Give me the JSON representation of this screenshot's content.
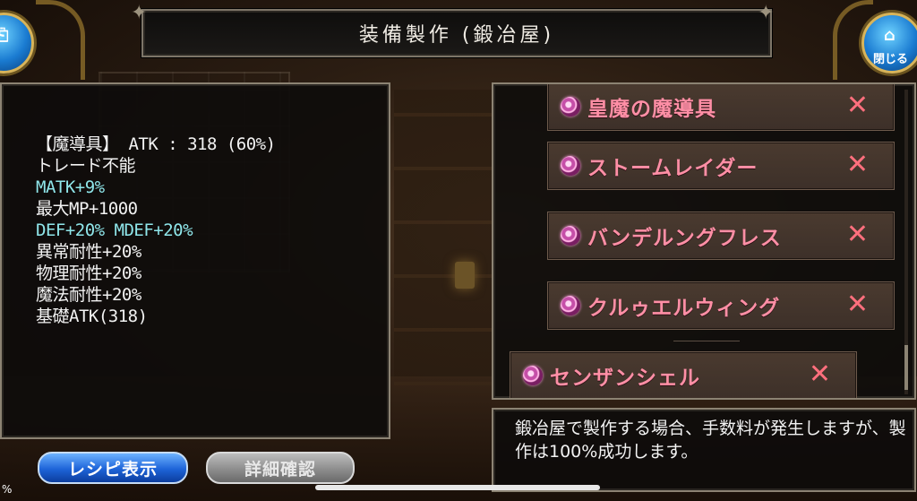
{
  "header": {
    "title": "装備製作 (鍛冶屋)"
  },
  "left_button": {
    "glyph": "⎗",
    "label": "る"
  },
  "right_button": {
    "glyph": "⌂",
    "label": "閉じる"
  },
  "item_stats": {
    "lines": [
      {
        "text": "【魔導具】 ATK : 318 (60%)",
        "color": "white"
      },
      {
        "text": "トレード不能",
        "color": "white"
      },
      {
        "text": "MATK+9%",
        "color": "cyan"
      },
      {
        "text": "最大MP+1000",
        "color": "white"
      },
      {
        "text": "DEF+20% MDEF+20%",
        "color": "cyan"
      },
      {
        "text": "異常耐性+20%",
        "color": "white"
      },
      {
        "text": "物理耐性+20%",
        "color": "white"
      },
      {
        "text": "魔法耐性+20%",
        "color": "white"
      },
      {
        "text": "基礎ATK(318)",
        "color": "white"
      }
    ]
  },
  "materials": [
    {
      "name": "皇魔の魔導具",
      "remove": "✕"
    },
    {
      "name": "ストームレイダー",
      "remove": "✕"
    },
    {
      "name": "バンデルングフレス",
      "remove": "✕"
    },
    {
      "name": "クルゥエルウィング",
      "remove": "✕"
    },
    {
      "name": "センザンシェル",
      "remove": "✕"
    }
  ],
  "description": "鍛冶屋で製作する場合、手数料が発生しますが、製作は100%成功します。",
  "buttons": {
    "recipe": "レシピ表示",
    "detail": "詳細確認"
  },
  "status": {
    "percent": "%"
  },
  "colors": {
    "accent_pink": "#ff8fa6",
    "cyan_text": "#8fe6ea",
    "button_blue": "#1d63d8"
  }
}
